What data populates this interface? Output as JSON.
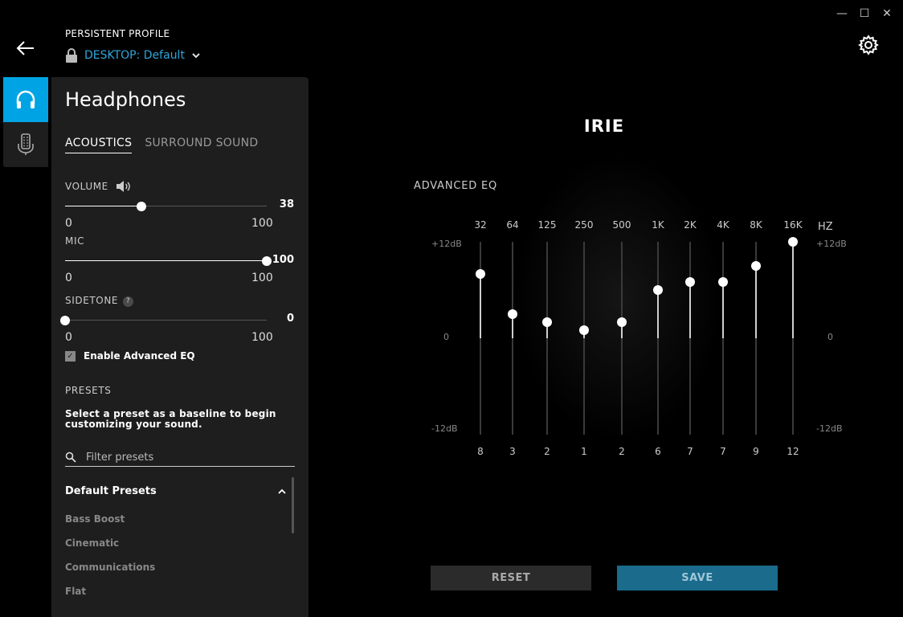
{
  "window": {
    "minimize": "—",
    "maximize": "☐",
    "close": "✕"
  },
  "header": {
    "profile_caption": "PERSISTENT PROFILE",
    "profile_name": "DESKTOP: Default"
  },
  "panel": {
    "title": "Headphones",
    "tabs": [
      {
        "label": "ACOUSTICS",
        "active": true
      },
      {
        "label": "SURROUND SOUND",
        "active": false
      }
    ],
    "volume": {
      "label": "VOLUME",
      "value": "38",
      "min": "0",
      "max": "100",
      "level": 0.38
    },
    "mic": {
      "label": "MIC",
      "value": "100",
      "min": "0",
      "max": "100",
      "level": 1.0
    },
    "sidetone": {
      "label": "SIDETONE",
      "help": "?",
      "value": "0",
      "min": "0",
      "max": "100",
      "level": 0.0
    },
    "advanced_eq": {
      "label": "Enable Advanced EQ",
      "checked": true,
      "check_glyph": "✓"
    },
    "presets": {
      "label": "PRESETS",
      "description": "Select a preset as a baseline to begin customizing your sound.",
      "filter_placeholder": "Filter presets",
      "group_title": "Default Presets",
      "items": [
        "Bass Boost",
        "Cinematic",
        "Communications",
        "Flat"
      ]
    }
  },
  "eq": {
    "preset_name": "IRIE",
    "section_label": "ADVANCED EQ",
    "unit": "HZ",
    "db_top": "+12dB",
    "db_mid": "0",
    "db_bottom": "-12dB",
    "range": [
      -12,
      12
    ],
    "bands": [
      {
        "freq": "32",
        "value": 8
      },
      {
        "freq": "64",
        "value": 3
      },
      {
        "freq": "125",
        "value": 2
      },
      {
        "freq": "250",
        "value": 1
      },
      {
        "freq": "500",
        "value": 2
      },
      {
        "freq": "1K",
        "value": 6
      },
      {
        "freq": "2K",
        "value": 7
      },
      {
        "freq": "4K",
        "value": 7
      },
      {
        "freq": "8K",
        "value": 9
      },
      {
        "freq": "16K",
        "value": 12
      }
    ]
  },
  "buttons": {
    "reset": "RESET",
    "save": "SAVE"
  },
  "colors": {
    "accent": "#00a4e4",
    "profile_link": "#2fa6dc",
    "save_bg": "#1b6b8c"
  }
}
